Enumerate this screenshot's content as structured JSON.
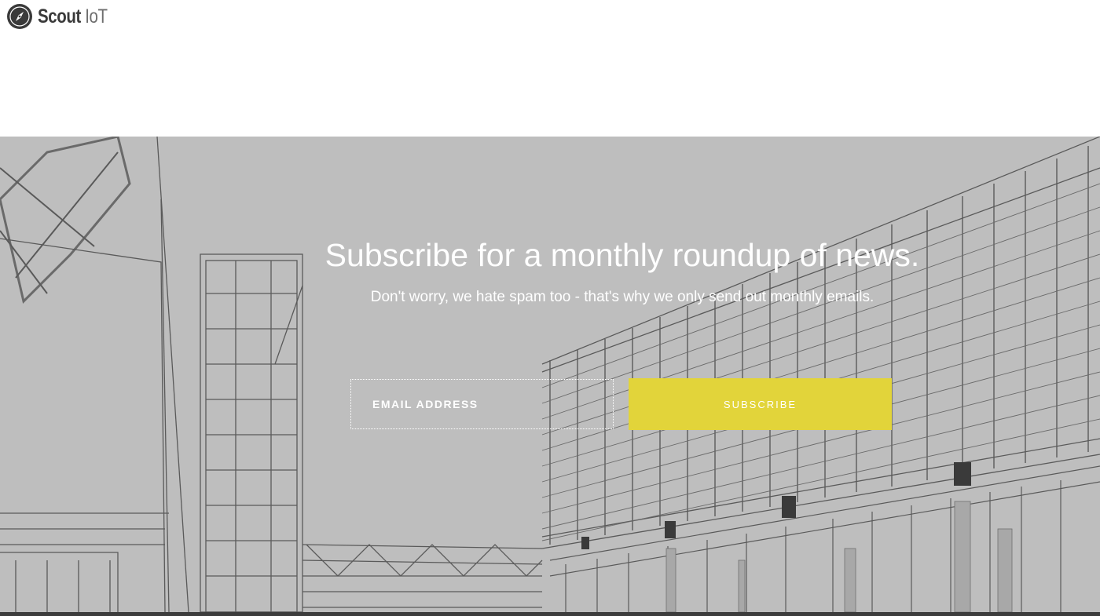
{
  "header": {
    "logo_word1": "Scout",
    "logo_word2": "IoT",
    "logo_icon": "compass-icon"
  },
  "hero": {
    "title": "Subscribe for a monthly roundup of news.",
    "subtitle": "Don't worry, we hate spam too - that's why we only send out monthly emails.",
    "email_placeholder": "EMAIL ADDRESS",
    "email_value": "",
    "subscribe_label": "SUBSCRIBE",
    "background": "architectural-line-drawing"
  },
  "colors": {
    "accent": "#e2d43a",
    "hero_bg": "#bebebe",
    "footer": "#3c3c3c",
    "text_on_hero": "#ffffff"
  }
}
